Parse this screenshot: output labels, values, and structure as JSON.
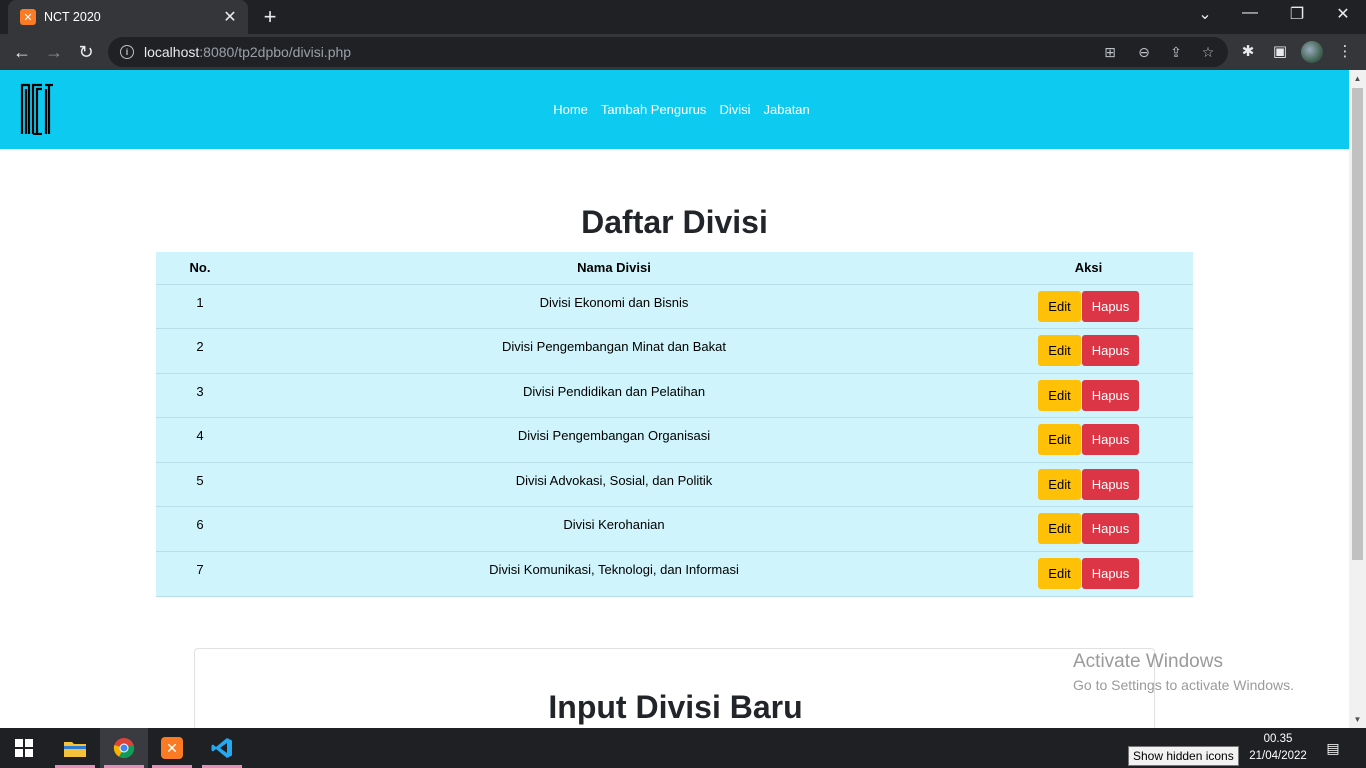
{
  "browser": {
    "tab_title": "NCT 2020",
    "tab_favicon": "xampp-icon",
    "url_host": "localhost",
    "url_path": ":8080/tp2dpbo/divisi.php"
  },
  "header": {
    "logo": "NCT",
    "nav": [
      "Home",
      "Tambah Pengurus",
      "Divisi",
      "Jabatan"
    ],
    "background": "#0dcaf0"
  },
  "main": {
    "title": "Daftar Divisi",
    "table": {
      "columns": [
        "No.",
        "Nama Divisi",
        "Aksi"
      ],
      "rows": [
        {
          "no": "1",
          "nama": "Divisi Ekonomi dan Bisnis"
        },
        {
          "no": "2",
          "nama": "Divisi Pengembangan Minat dan Bakat"
        },
        {
          "no": "3",
          "nama": "Divisi Pendidikan dan Pelatihan"
        },
        {
          "no": "4",
          "nama": "Divisi Pengembangan Organisasi"
        },
        {
          "no": "5",
          "nama": "Divisi Advokasi, Sosial, dan Politik"
        },
        {
          "no": "6",
          "nama": "Divisi Kerohanian"
        },
        {
          "no": "7",
          "nama": "Divisi Komunikasi, Teknologi, dan Informasi"
        }
      ],
      "edit_label": "Edit",
      "delete_label": "Hapus",
      "row_color": "#cff4fc",
      "edit_color": "#ffc107",
      "delete_color": "#dc3545"
    },
    "form_title": "Input Divisi Baru"
  },
  "watermark": {
    "line1": "Activate Windows",
    "line2": "Go to Settings to activate Windows."
  },
  "taskbar": {
    "apps": [
      "windows-start-icon",
      "file-explorer-icon",
      "chrome-icon",
      "xampp-icon",
      "vscode-icon"
    ],
    "time": "00.35",
    "date": "21/04/2022",
    "tooltip": "Show hidden icons"
  }
}
